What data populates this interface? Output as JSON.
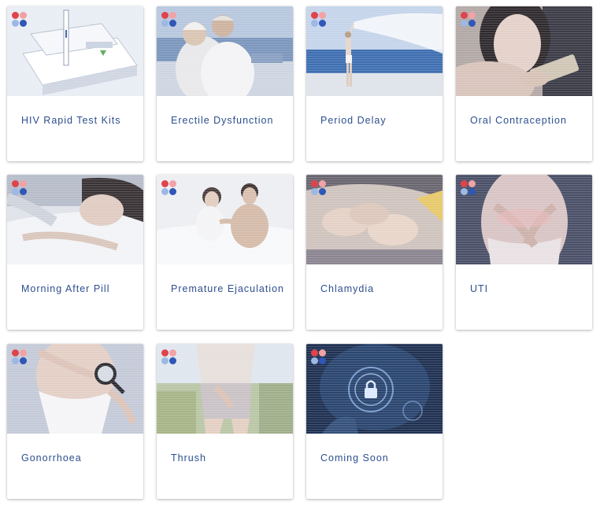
{
  "colors": {
    "title_text": "#2c4e8e",
    "logo_red": "#e0434b",
    "logo_pink": "#f1a2a6",
    "logo_light_blue": "#9db8e4",
    "logo_blue": "#2f57b7"
  },
  "cards": [
    {
      "title": "HIV Rapid Test Kits",
      "image": "hiv-test-kit-image"
    },
    {
      "title": "Erectile Dysfunction",
      "image": "older-couple-beach-image"
    },
    {
      "title": "Period Delay",
      "image": "woman-beach-scarf-image"
    },
    {
      "title": "Oral Contraception",
      "image": "woman-holding-pill-pack-image"
    },
    {
      "title": "Morning After Pill",
      "image": "woman-lying-bed-image"
    },
    {
      "title": "Premature Ejaculation",
      "image": "couple-in-bed-image"
    },
    {
      "title": "Chlamydia",
      "image": "feet-under-sheets-image"
    },
    {
      "title": "UTI",
      "image": "woman-abdomen-pain-image"
    },
    {
      "title": "Gonorrhoea",
      "image": "woman-magnifying-glass-image"
    },
    {
      "title": "Thrush",
      "image": "woman-hands-groin-image"
    },
    {
      "title": "Coming Soon",
      "image": "digital-padlock-image"
    }
  ]
}
